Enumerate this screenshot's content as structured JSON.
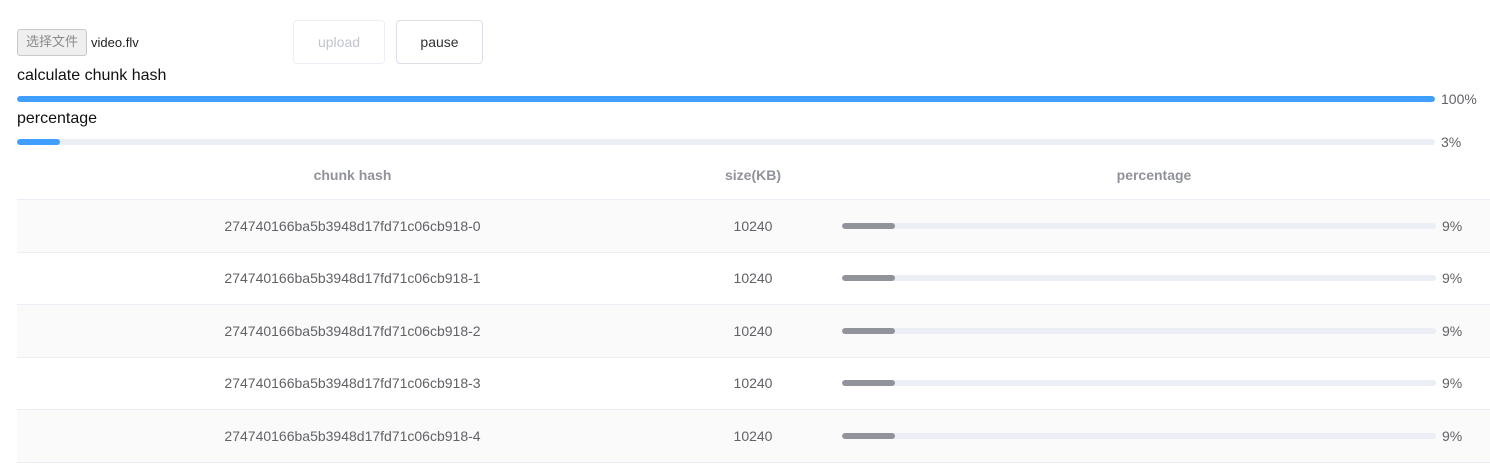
{
  "file_input": {
    "button_label": "选择文件",
    "file_name": "video.flv"
  },
  "buttons": {
    "upload_label": "upload",
    "pause_label": "pause"
  },
  "hash_progress": {
    "label": "calculate chunk hash",
    "value": 100,
    "text": "100%"
  },
  "upload_progress": {
    "label": "percentage",
    "value": 3,
    "text": "3%"
  },
  "colors": {
    "primary": "#409eff",
    "chunk_bar": "#909399",
    "track": "#ebeef5"
  },
  "table": {
    "columns": [
      "chunk hash",
      "size(KB)",
      "percentage"
    ],
    "rows": [
      {
        "hash": "274740166ba5b3948d17fd71c06cb918-0",
        "size": "10240",
        "percentage": 9,
        "percentage_text": "9%"
      },
      {
        "hash": "274740166ba5b3948d17fd71c06cb918-1",
        "size": "10240",
        "percentage": 9,
        "percentage_text": "9%"
      },
      {
        "hash": "274740166ba5b3948d17fd71c06cb918-2",
        "size": "10240",
        "percentage": 9,
        "percentage_text": "9%"
      },
      {
        "hash": "274740166ba5b3948d17fd71c06cb918-3",
        "size": "10240",
        "percentage": 9,
        "percentage_text": "9%"
      },
      {
        "hash": "274740166ba5b3948d17fd71c06cb918-4",
        "size": "10240",
        "percentage": 9,
        "percentage_text": "9%"
      }
    ]
  }
}
